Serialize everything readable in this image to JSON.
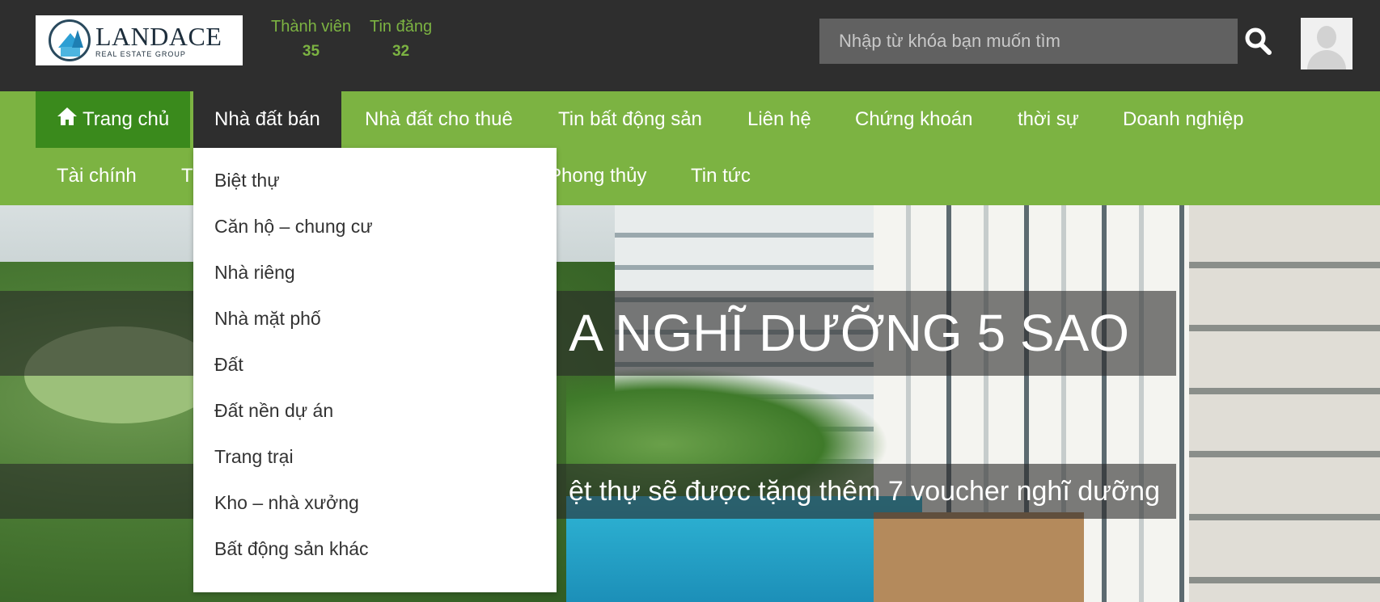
{
  "header": {
    "logo_name": "LANDACE",
    "logo_sub": "REAL ESTATE GROUP",
    "stats": [
      {
        "label": "Thành viên",
        "value": "35"
      },
      {
        "label": "Tin đăng",
        "value": "32"
      }
    ],
    "search_placeholder": "Nhập từ khóa bạn muốn tìm",
    "icons": {
      "search": "search-icon",
      "avatar": "user-avatar-icon"
    }
  },
  "nav": {
    "row1": [
      "Trang chủ",
      "Nhà đất bán",
      "Nhà đất cho thuê",
      "Tin bất động sản",
      "Liên hệ",
      "Chứng khoán",
      "thời sự",
      "Doanh nghiệp"
    ],
    "row2_visible": [
      "Tài chính",
      "T",
      "Phong thủy",
      "Tin tức"
    ],
    "active": "Nhà đất bán"
  },
  "dropdown": {
    "items": [
      "Biệt thự",
      "Căn hộ – chung cư",
      "Nhà riêng",
      "Nhà mặt phố",
      "Đất",
      "Đất nền dự án",
      "Trang trại",
      "Kho – nhà xưởng",
      "Bất động sản khác"
    ]
  },
  "hero": {
    "headline_visible": "A NGHĨ DƯỠNG 5 SAO",
    "subline_visible": "ệt thự sẽ được tặng thêm 7 voucher nghĩ dưỡng"
  },
  "colors": {
    "topbar": "#2e2e2e",
    "nav_green": "#7cb342",
    "home_green": "#3a8a1c",
    "stat_green": "#7cb342"
  }
}
